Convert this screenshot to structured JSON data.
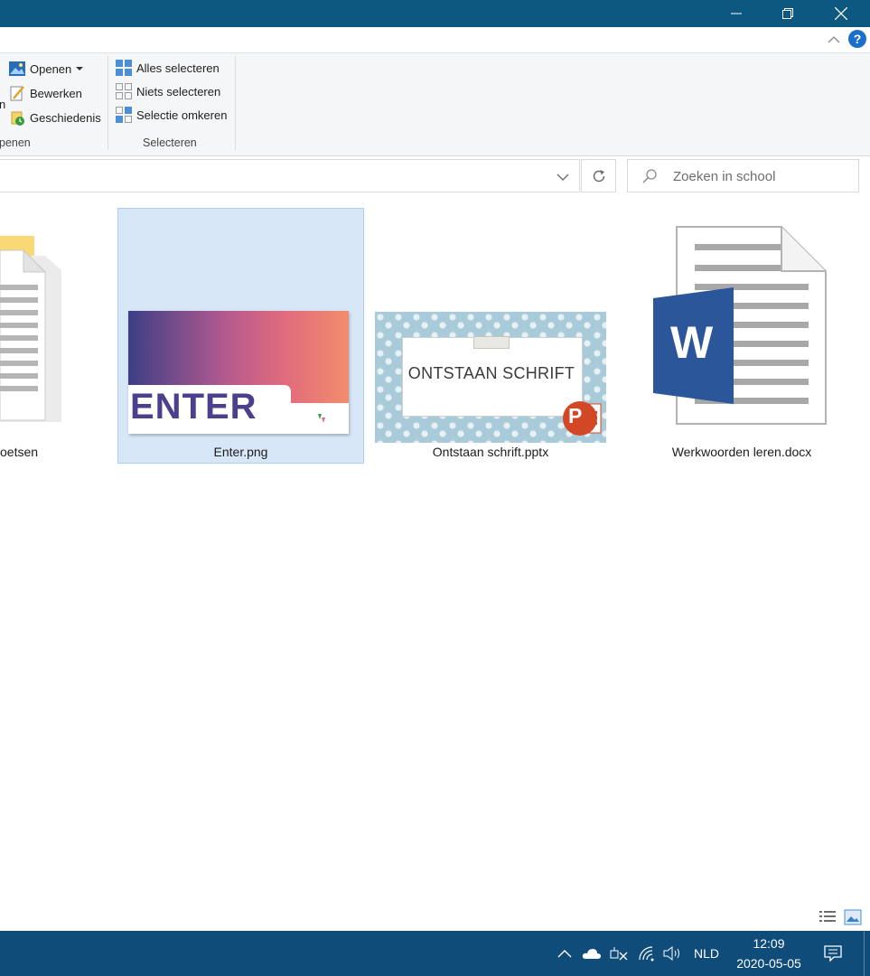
{
  "window": {
    "controls": [
      "minimize-icon",
      "restore-icon",
      "close-icon"
    ]
  },
  "ribbon": {
    "open_group": {
      "partial_item": "n",
      "items": [
        {
          "label": "Openen",
          "icon": "open-icon",
          "has_dropdown": true
        },
        {
          "label": "Bewerken",
          "icon": "edit-icon"
        },
        {
          "label": "Geschiedenis",
          "icon": "history-icon"
        }
      ],
      "group_label": "penen"
    },
    "select_group": {
      "items": [
        {
          "label": "Alles selecteren",
          "icon": "select-all-icon"
        },
        {
          "label": "Niets selecteren",
          "icon": "select-none-icon"
        },
        {
          "label": "Selectie omkeren",
          "icon": "invert-selection-icon"
        }
      ],
      "group_label": "Selecteren"
    },
    "help_label": "?"
  },
  "address": {
    "search_placeholder": "Zoeken in school"
  },
  "files": [
    {
      "name": "oetsen",
      "type": "folder",
      "selected": false
    },
    {
      "name": "Enter.png",
      "type": "image",
      "selected": true,
      "thumbnail_text": "ENTER"
    },
    {
      "name": "Ontstaan schrift.pptx",
      "type": "pptx",
      "selected": false,
      "thumbnail_text": "ONTSTAAN SCHRIFT",
      "badge": "P"
    },
    {
      "name": "Werkwoorden leren.docx",
      "type": "docx",
      "selected": false,
      "badge": "W"
    }
  ],
  "taskbar": {
    "language": "NLD",
    "time": "12:09",
    "date": "2020-05-05"
  },
  "colors": {
    "titlebar": "#0d5880",
    "taskbar": "#0f4c7a",
    "selection": "#d7e7f7",
    "word_blue": "#2b579a",
    "powerpoint_red": "#d24726"
  }
}
